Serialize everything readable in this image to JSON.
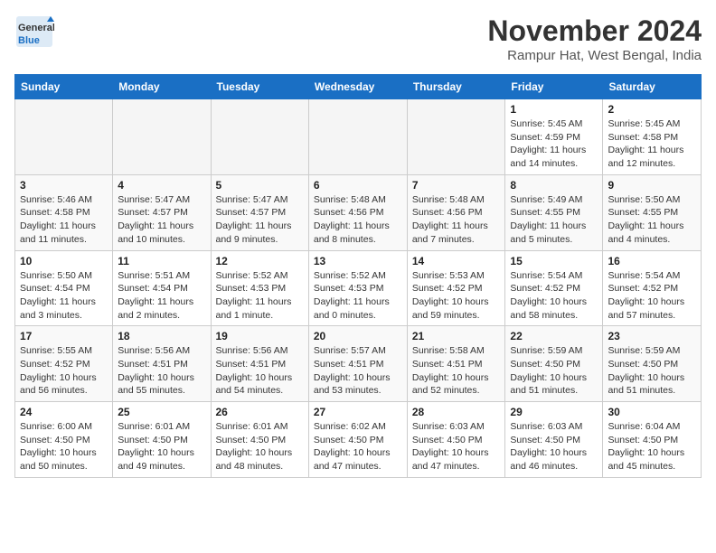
{
  "header": {
    "logo_general": "General",
    "logo_blue": "Blue",
    "month": "November 2024",
    "location": "Rampur Hat, West Bengal, India"
  },
  "days_of_week": [
    "Sunday",
    "Monday",
    "Tuesday",
    "Wednesday",
    "Thursday",
    "Friday",
    "Saturday"
  ],
  "weeks": [
    [
      {
        "day": "",
        "info": ""
      },
      {
        "day": "",
        "info": ""
      },
      {
        "day": "",
        "info": ""
      },
      {
        "day": "",
        "info": ""
      },
      {
        "day": "",
        "info": ""
      },
      {
        "day": "1",
        "info": "Sunrise: 5:45 AM\nSunset: 4:59 PM\nDaylight: 11 hours and 14 minutes."
      },
      {
        "day": "2",
        "info": "Sunrise: 5:45 AM\nSunset: 4:58 PM\nDaylight: 11 hours and 12 minutes."
      }
    ],
    [
      {
        "day": "3",
        "info": "Sunrise: 5:46 AM\nSunset: 4:58 PM\nDaylight: 11 hours and 11 minutes."
      },
      {
        "day": "4",
        "info": "Sunrise: 5:47 AM\nSunset: 4:57 PM\nDaylight: 11 hours and 10 minutes."
      },
      {
        "day": "5",
        "info": "Sunrise: 5:47 AM\nSunset: 4:57 PM\nDaylight: 11 hours and 9 minutes."
      },
      {
        "day": "6",
        "info": "Sunrise: 5:48 AM\nSunset: 4:56 PM\nDaylight: 11 hours and 8 minutes."
      },
      {
        "day": "7",
        "info": "Sunrise: 5:48 AM\nSunset: 4:56 PM\nDaylight: 11 hours and 7 minutes."
      },
      {
        "day": "8",
        "info": "Sunrise: 5:49 AM\nSunset: 4:55 PM\nDaylight: 11 hours and 5 minutes."
      },
      {
        "day": "9",
        "info": "Sunrise: 5:50 AM\nSunset: 4:55 PM\nDaylight: 11 hours and 4 minutes."
      }
    ],
    [
      {
        "day": "10",
        "info": "Sunrise: 5:50 AM\nSunset: 4:54 PM\nDaylight: 11 hours and 3 minutes."
      },
      {
        "day": "11",
        "info": "Sunrise: 5:51 AM\nSunset: 4:54 PM\nDaylight: 11 hours and 2 minutes."
      },
      {
        "day": "12",
        "info": "Sunrise: 5:52 AM\nSunset: 4:53 PM\nDaylight: 11 hours and 1 minute."
      },
      {
        "day": "13",
        "info": "Sunrise: 5:52 AM\nSunset: 4:53 PM\nDaylight: 11 hours and 0 minutes."
      },
      {
        "day": "14",
        "info": "Sunrise: 5:53 AM\nSunset: 4:52 PM\nDaylight: 10 hours and 59 minutes."
      },
      {
        "day": "15",
        "info": "Sunrise: 5:54 AM\nSunset: 4:52 PM\nDaylight: 10 hours and 58 minutes."
      },
      {
        "day": "16",
        "info": "Sunrise: 5:54 AM\nSunset: 4:52 PM\nDaylight: 10 hours and 57 minutes."
      }
    ],
    [
      {
        "day": "17",
        "info": "Sunrise: 5:55 AM\nSunset: 4:52 PM\nDaylight: 10 hours and 56 minutes."
      },
      {
        "day": "18",
        "info": "Sunrise: 5:56 AM\nSunset: 4:51 PM\nDaylight: 10 hours and 55 minutes."
      },
      {
        "day": "19",
        "info": "Sunrise: 5:56 AM\nSunset: 4:51 PM\nDaylight: 10 hours and 54 minutes."
      },
      {
        "day": "20",
        "info": "Sunrise: 5:57 AM\nSunset: 4:51 PM\nDaylight: 10 hours and 53 minutes."
      },
      {
        "day": "21",
        "info": "Sunrise: 5:58 AM\nSunset: 4:51 PM\nDaylight: 10 hours and 52 minutes."
      },
      {
        "day": "22",
        "info": "Sunrise: 5:59 AM\nSunset: 4:50 PM\nDaylight: 10 hours and 51 minutes."
      },
      {
        "day": "23",
        "info": "Sunrise: 5:59 AM\nSunset: 4:50 PM\nDaylight: 10 hours and 51 minutes."
      }
    ],
    [
      {
        "day": "24",
        "info": "Sunrise: 6:00 AM\nSunset: 4:50 PM\nDaylight: 10 hours and 50 minutes."
      },
      {
        "day": "25",
        "info": "Sunrise: 6:01 AM\nSunset: 4:50 PM\nDaylight: 10 hours and 49 minutes."
      },
      {
        "day": "26",
        "info": "Sunrise: 6:01 AM\nSunset: 4:50 PM\nDaylight: 10 hours and 48 minutes."
      },
      {
        "day": "27",
        "info": "Sunrise: 6:02 AM\nSunset: 4:50 PM\nDaylight: 10 hours and 47 minutes."
      },
      {
        "day": "28",
        "info": "Sunrise: 6:03 AM\nSunset: 4:50 PM\nDaylight: 10 hours and 47 minutes."
      },
      {
        "day": "29",
        "info": "Sunrise: 6:03 AM\nSunset: 4:50 PM\nDaylight: 10 hours and 46 minutes."
      },
      {
        "day": "30",
        "info": "Sunrise: 6:04 AM\nSunset: 4:50 PM\nDaylight: 10 hours and 45 minutes."
      }
    ]
  ]
}
